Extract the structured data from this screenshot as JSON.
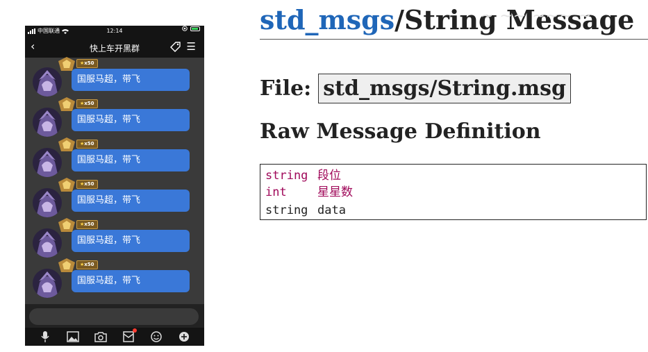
{
  "phone": {
    "status": {
      "carrier": "中国联通",
      "time": "12:14"
    },
    "nav": {
      "back": "‹",
      "title": "快上车开黑群",
      "menu": "☰"
    },
    "messages": [
      {
        "text": "国服马超，带飞",
        "stars": "x50"
      },
      {
        "text": "国服马超，带飞",
        "stars": "x50"
      },
      {
        "text": "国服马超，带飞",
        "stars": "x50"
      },
      {
        "text": "国服马超，带飞",
        "stars": "x50"
      },
      {
        "text": "国服马超，带飞",
        "stars": "x50"
      },
      {
        "text": "国服马超，带飞",
        "stars": "x50"
      }
    ],
    "toolbar": [
      "mic-icon",
      "image-icon",
      "camera-icon",
      "red-packet-icon",
      "emoji-icon",
      "plus-icon"
    ]
  },
  "doc": {
    "title_pkg": "std_msgs",
    "title_rest": "/String Message",
    "file_label": "File:",
    "file_name": "std_msgs/String.msg",
    "raw_heading": "Raw Message Definition",
    "fields": [
      {
        "type": "string",
        "name": "段位"
      },
      {
        "type": "int",
        "name": "星星数"
      },
      {
        "type": "string",
        "name": "data"
      }
    ],
    "colors": {
      "package": "#1f66b8",
      "added_fields": "#a0095a",
      "bubble": "#3a78d8"
    }
  }
}
